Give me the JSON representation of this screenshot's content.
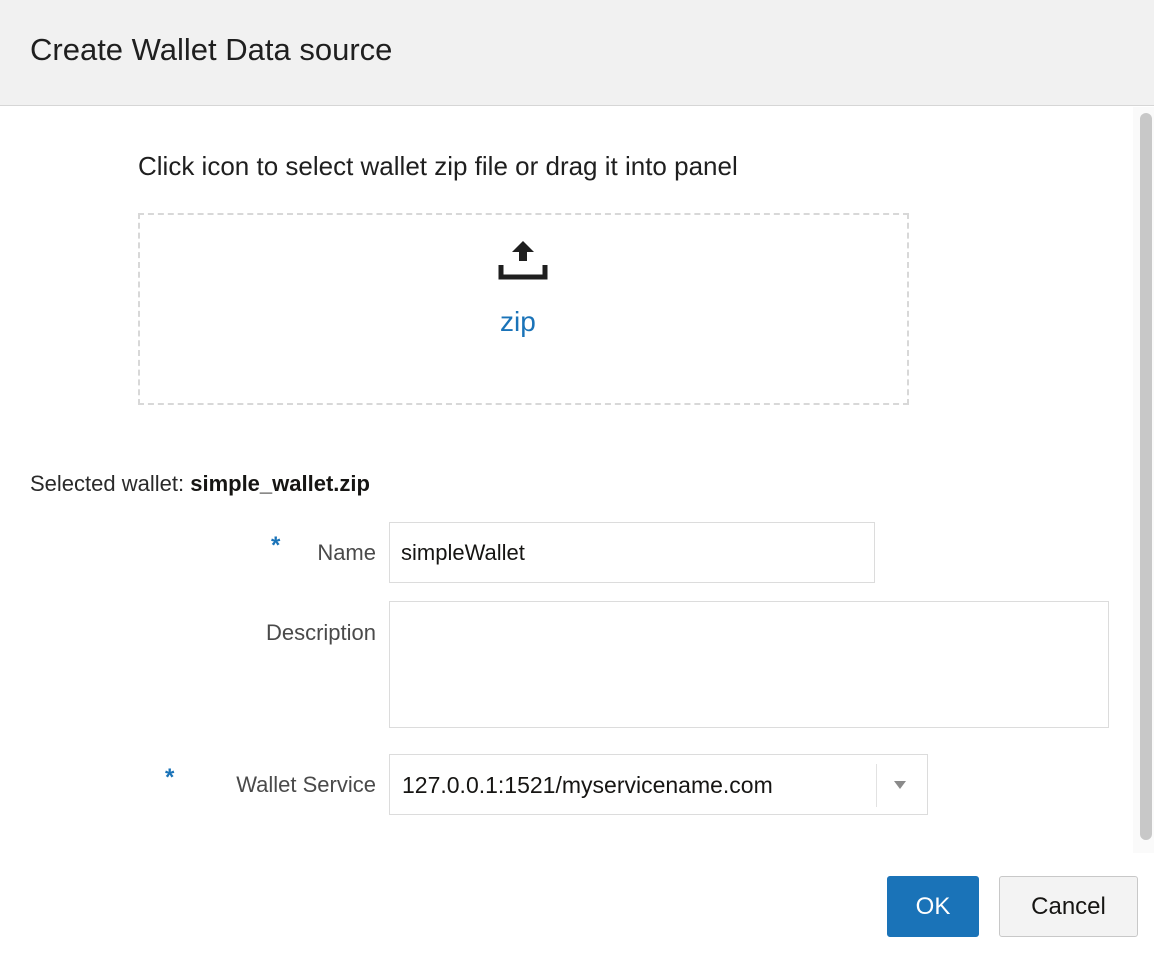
{
  "dialog": {
    "title": "Create Wallet Data source"
  },
  "upload": {
    "instruction": "Click icon to select wallet zip file or drag it into panel",
    "icon": "upload-icon",
    "file_type_label": "zip"
  },
  "selected_wallet": {
    "label": "Selected wallet:",
    "file_name": "simple_wallet.zip"
  },
  "form": {
    "required_marker": "*",
    "name": {
      "label": "Name",
      "value": "simpleWallet",
      "required": true
    },
    "description": {
      "label": "Description",
      "value": "",
      "required": false
    },
    "wallet_service": {
      "label": "Wallet Service",
      "value": "127.0.0.1:1521/myservicename.com",
      "required": true,
      "icon": "chevron-down-icon"
    }
  },
  "buttons": {
    "ok_label": "OK",
    "cancel_label": "Cancel"
  },
  "colors": {
    "accent": "#1a73b8",
    "header_bg": "#f1f1f1"
  }
}
